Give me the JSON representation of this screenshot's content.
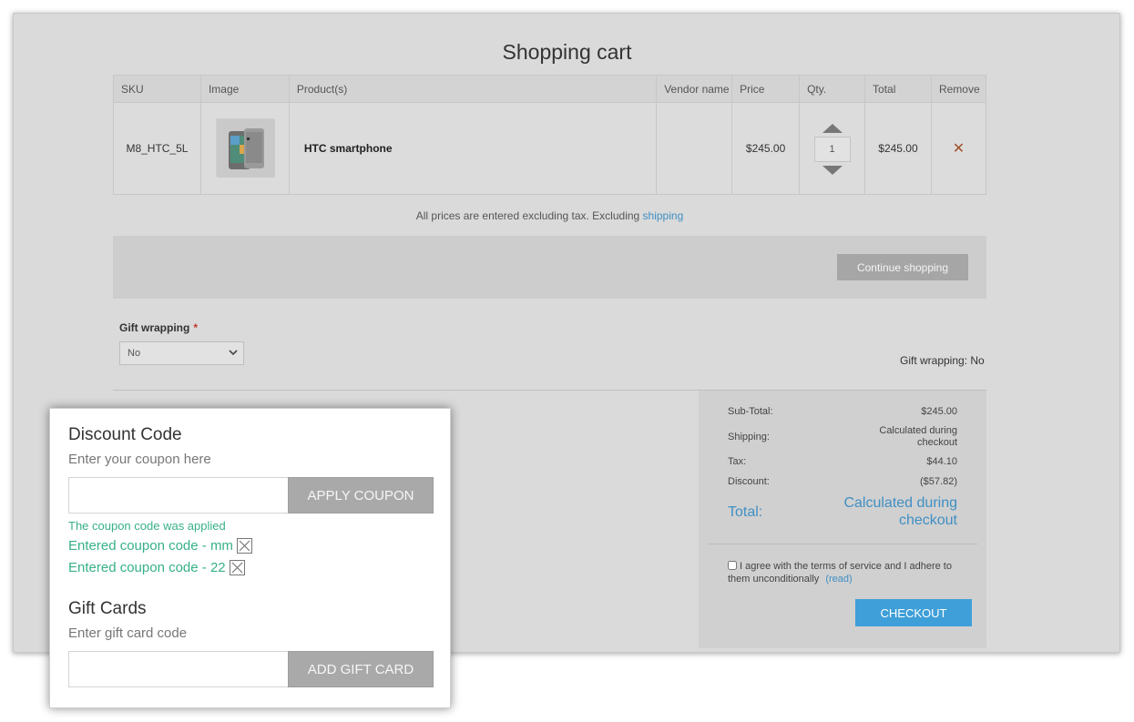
{
  "page": {
    "title": "Shopping cart"
  },
  "cart": {
    "headers": [
      "SKU",
      "Image",
      "Product(s)",
      "Vendor name",
      "Price",
      "Qty.",
      "Total",
      "Remove"
    ],
    "items": [
      {
        "sku": "M8_HTC_5L",
        "image": "phone-image",
        "product": "HTC smartphone",
        "vendor": "",
        "price": "$245.00",
        "qty": "1",
        "total": "$245.00",
        "remove": "✕"
      }
    ],
    "tax_note": "All prices are entered excluding tax. Excluding",
    "tax_note_link": "shipping"
  },
  "continue_shopping": "Continue shopping",
  "gift_wrapping": {
    "label": "Gift wrapping",
    "required_mark": "*",
    "selected": "No",
    "status": "Gift wrapping: No"
  },
  "totals": {
    "subtotal_label": "Sub-Total:",
    "subtotal": "$245.00",
    "shipping_label": "Shipping:",
    "shipping_line1": "Calculated during",
    "shipping_line2": "checkout",
    "tax_label": "Tax:",
    "tax": "$44.10",
    "discount_label": "Discount:",
    "discount": "($57.82)",
    "total_label": "Total:",
    "total_line1": "Calculated during",
    "total_line2": "checkout"
  },
  "terms": {
    "text": "I agree with the terms of service and I adhere to them unconditionally",
    "link": "(read)"
  },
  "checkout": "CHECKOUT",
  "discount": {
    "heading": "Discount Code",
    "subheading": "Enter your coupon here",
    "button": "APPLY COUPON",
    "applied_message": "The coupon code was applied",
    "coupons": [
      "Entered coupon code - mm",
      "Entered coupon code - 22"
    ]
  },
  "gift_cards": {
    "heading": "Gift Cards",
    "subheading": "Enter gift card code",
    "button": "ADD GIFT CARD"
  },
  "colors": {
    "accent": "#3f9fd8",
    "link": "#3f8fc4",
    "success": "#36b08a",
    "remove": "#a0522d"
  }
}
